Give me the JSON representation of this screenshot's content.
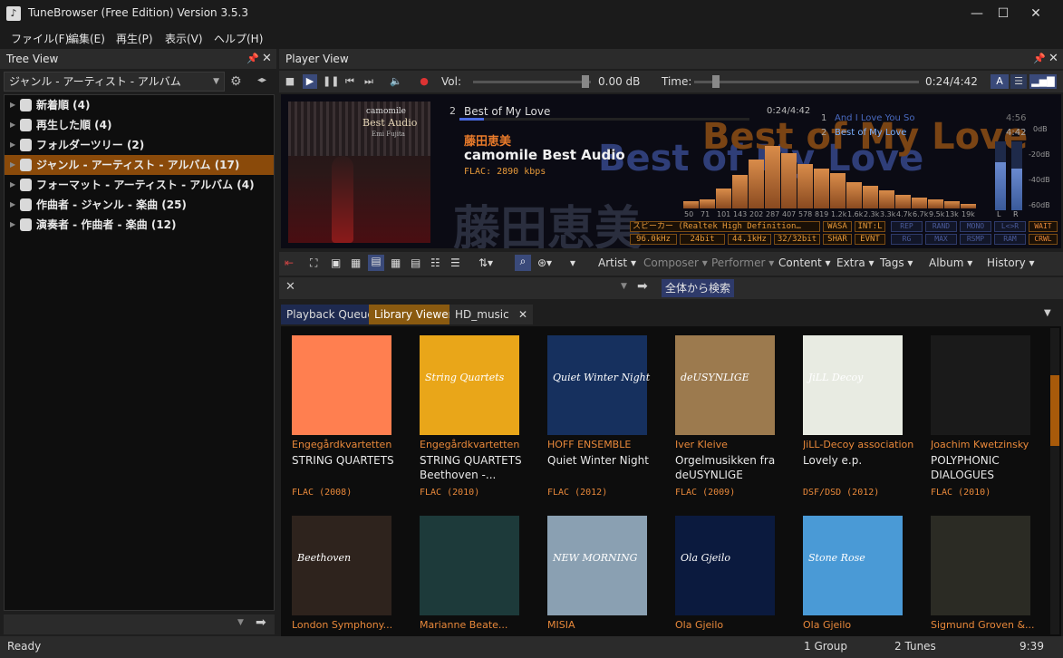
{
  "window": {
    "title": "TuneBrowser (Free Edition) Version 3.5.3",
    "minimize": "—",
    "maximize": "☐",
    "close": "✕"
  },
  "menu": [
    "ファイル(F)",
    "編集(E)",
    "再生(P)",
    "表示(V)",
    "ヘルプ(H)"
  ],
  "tree_view": {
    "header": "Tree View",
    "selector": "ジャンル - アーティスト - アルバム",
    "items": [
      {
        "label": "新着順 (4)"
      },
      {
        "label": "再生した順 (4)"
      },
      {
        "label": "フォルダーツリー (2)"
      },
      {
        "label": "ジャンル - アーティスト - アルバム (17)",
        "selected": true
      },
      {
        "label": "フォーマット - アーティスト - アルバム (4)"
      },
      {
        "label": "作曲者 - ジャンル - 楽曲 (25)"
      },
      {
        "label": "演奏者 - 作曲者 - 楽曲 (12)"
      }
    ]
  },
  "player": {
    "header": "Player View",
    "vol_label": "Vol:",
    "vol_value": "0.00 dB",
    "time_label": "Time:",
    "time_value": "0:24/4:42"
  },
  "now_playing": {
    "cover_text_1": "camomile",
    "cover_text_2": "Best Audio",
    "cover_text_3": "Emi Fujita",
    "track_no": "2",
    "track_title": "Best of My Love",
    "track_time": "0:24/4:42",
    "progress": 0.085,
    "artist": "藤田恵美",
    "album": "camomile Best Audio",
    "format": "FLAC: 2890 kbps",
    "ghost_title": "Best of My Love",
    "ghost_artist": "藤田恵美",
    "playlist": [
      {
        "no": "1",
        "title": "And I Love You So",
        "time": "4:56"
      },
      {
        "no": "2",
        "title": "Best of My Love",
        "time": "4:42"
      }
    ],
    "spectrum": {
      "bands": [
        "50",
        "71",
        "101",
        "143",
        "202",
        "287",
        "407",
        "578",
        "819",
        "1.2k",
        "1.6k",
        "2.3k",
        "3.3k",
        "4.7k",
        "6.7k",
        "9.5k",
        "13k",
        "19k"
      ],
      "levels": [
        0.08,
        0.1,
        0.22,
        0.38,
        0.55,
        0.7,
        0.62,
        0.5,
        0.45,
        0.4,
        0.3,
        0.25,
        0.2,
        0.15,
        0.12,
        0.1,
        0.08,
        0.05
      ],
      "db_labels": [
        "0dB",
        "-20dB",
        "-40dB",
        "-60dB"
      ],
      "lr": [
        "L",
        "R"
      ],
      "meter_levels": [
        0.7,
        0.6
      ]
    },
    "output_device": "スピーカー (Realtek High Definition…",
    "output_cells": [
      "WASA",
      "INT:L",
      "SHAR",
      "EVNT"
    ],
    "rates": [
      "96.0kHz",
      "24bit",
      "44.1kHz",
      "32/32bit"
    ],
    "flags_row1": [
      "REP",
      "RAND",
      "MONO",
      "L<>R",
      "WAIT"
    ],
    "flags_row2": [
      "RG",
      "MAX",
      "RSMP",
      "RAM",
      "CRWL"
    ]
  },
  "browse_toolbar": {
    "artist": "Artist",
    "composer": "Composer",
    "performer": "Performer",
    "content": "Content",
    "extra": "Extra",
    "tags": "Tags",
    "album": "Album",
    "history": "History"
  },
  "search": {
    "button": "全体から検索"
  },
  "tabs": [
    "Playback Queue",
    "Library Viewer",
    "HD_music"
  ],
  "albums": [
    {
      "artist": "Engegårdkvartetten",
      "title": "STRING QUARTETS",
      "format": "FLAC (2008)",
      "color": "#ff7f50",
      "art_text": ""
    },
    {
      "artist": "Engegårdkvartetten",
      "title": "STRING QUARTETS Beethoven -...",
      "format": "FLAC (2010)",
      "color": "#e9a619",
      "art_text": "String Quartets"
    },
    {
      "artist": "HOFF ENSEMBLE",
      "title": "Quiet Winter Night",
      "format": "FLAC (2012)",
      "color": "#16305e",
      "art_text": "Quiet Winter Night"
    },
    {
      "artist": "Iver Kleive",
      "title": "Orgelmusikken fra deUSYNLIGE",
      "format": "FLAC (2009)",
      "color": "#9c7a4e",
      "art_text": "deUSYNLIGE"
    },
    {
      "artist": "JiLL-Decoy association",
      "title": "Lovely e.p.",
      "format": "DSF/DSD (2012)",
      "color": "#e8ebe2",
      "art_text": "JiLL Decoy"
    },
    {
      "artist": "Joachim Kwetzinsky",
      "title": "POLYPHONIC DIALOGUES",
      "format": "FLAC (2010)",
      "color": "#1a1a1a",
      "art_text": ""
    },
    {
      "artist": "London Symphony...",
      "title": "",
      "format": "",
      "color": "#2e231d",
      "art_text": "Beethoven"
    },
    {
      "artist": "Marianne Beate...",
      "title": "",
      "format": "",
      "color": "#1d3a3a",
      "art_text": ""
    },
    {
      "artist": "MISIA",
      "title": "",
      "format": "",
      "color": "#8aa0b2",
      "art_text": "NEW MORNING"
    },
    {
      "artist": "Ola Gjeilo",
      "title": "",
      "format": "",
      "color": "#0b1a3e",
      "art_text": "Ola Gjeilo"
    },
    {
      "artist": "Ola Gjeilo",
      "title": "",
      "format": "",
      "color": "#4a9ad6",
      "art_text": "Stone Rose"
    },
    {
      "artist": "Sigmund Groven &...",
      "title": "",
      "format": "",
      "color": "#2b2b24",
      "art_text": ""
    }
  ],
  "status": {
    "left": "Ready",
    "groups": "1 Group",
    "tunes": "2 Tunes",
    "clock": "9:39"
  }
}
